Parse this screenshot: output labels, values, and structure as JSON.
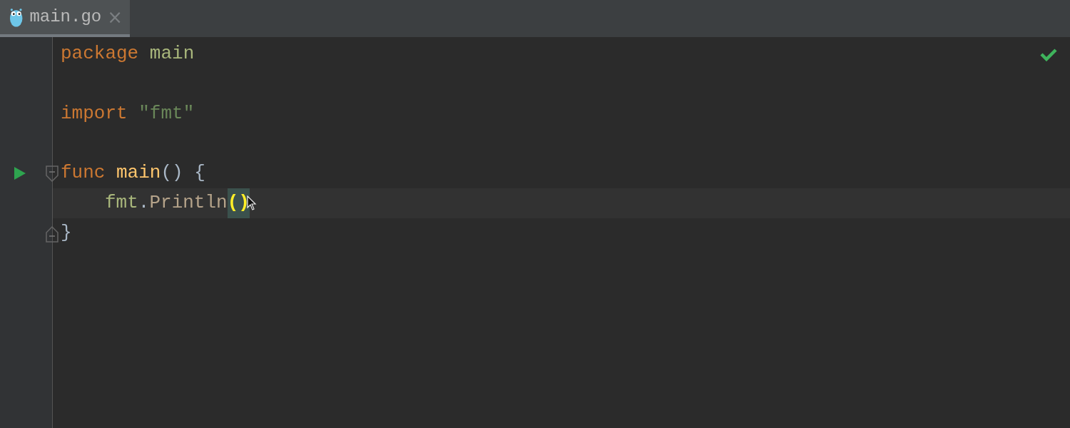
{
  "tabs": [
    {
      "label": "main.go",
      "selected": true,
      "close": "×"
    }
  ],
  "editor": {
    "ok_check": true,
    "lines": [
      {
        "tokens": [
          {
            "kind": "keyword",
            "text": "package "
          },
          {
            "kind": "package",
            "text": "main"
          }
        ]
      },
      {
        "blank": true
      },
      {
        "tokens": [
          {
            "kind": "keyword",
            "text": "import "
          },
          {
            "kind": "string",
            "text": "\"fmt\""
          }
        ]
      },
      {
        "blank": true
      },
      {
        "run": true,
        "fold_start": true,
        "tokens": [
          {
            "kind": "keyword",
            "text": "func "
          },
          {
            "kind": "function",
            "text": "main"
          },
          {
            "kind": "punct",
            "text": "() {"
          }
        ]
      },
      {
        "current": true,
        "cursor": true,
        "indented": true,
        "tokens": [
          {
            "kind": "package",
            "text": "fmt"
          },
          {
            "kind": "punct",
            "text": "."
          },
          {
            "kind": "call",
            "text": "Println"
          },
          {
            "kind": "punct",
            "text": "(",
            "matched": true
          },
          {
            "kind": "punct",
            "text": ")",
            "matched": true
          }
        ]
      },
      {
        "fold_end": true,
        "tokens": [
          {
            "kind": "punct",
            "text": "}"
          }
        ]
      }
    ]
  }
}
